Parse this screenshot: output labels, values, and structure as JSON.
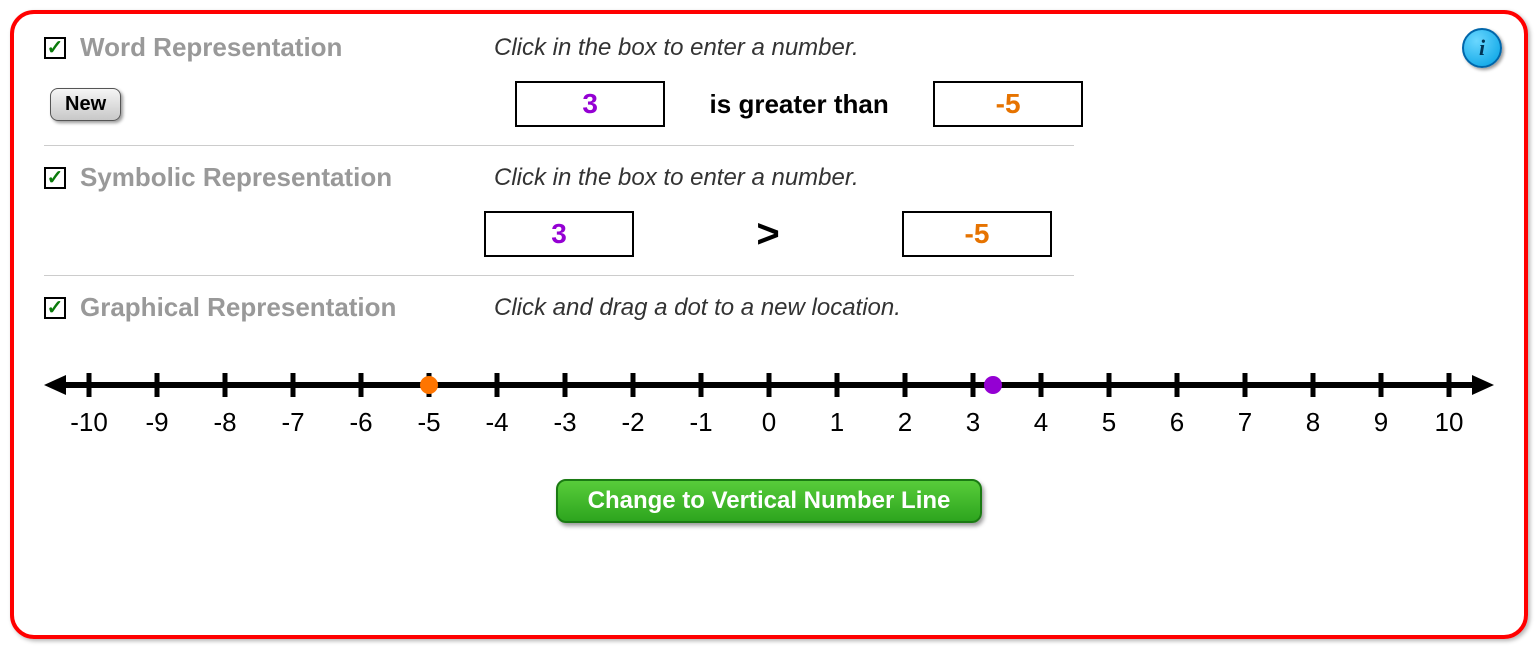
{
  "sections": {
    "word": {
      "title": "Word Representation",
      "hint": "Click in the box to enter a number.",
      "left_value": "3",
      "comparison_text": "is greater than",
      "right_value": "-5"
    },
    "symbolic": {
      "title": "Symbolic Representation",
      "hint": "Click in the box to enter a number.",
      "left_value": "3",
      "comparison_symbol": ">",
      "right_value": "-5"
    },
    "graphical": {
      "title": "Graphical Representation",
      "hint": "Click and drag a dot to a new location."
    }
  },
  "buttons": {
    "new": "New",
    "change_orientation": "Change to Vertical Number Line",
    "info": "i"
  },
  "number_line": {
    "min": -10,
    "max": 10,
    "ticks": [
      "-10",
      "-9",
      "-8",
      "-7",
      "-6",
      "-5",
      "-4",
      "-3",
      "-2",
      "-1",
      "0",
      "1",
      "2",
      "3",
      "4",
      "5",
      "6",
      "7",
      "8",
      "9",
      "10"
    ],
    "dots": [
      {
        "value": -5,
        "color": "orange"
      },
      {
        "value": 3.3,
        "color": "purple"
      }
    ]
  }
}
